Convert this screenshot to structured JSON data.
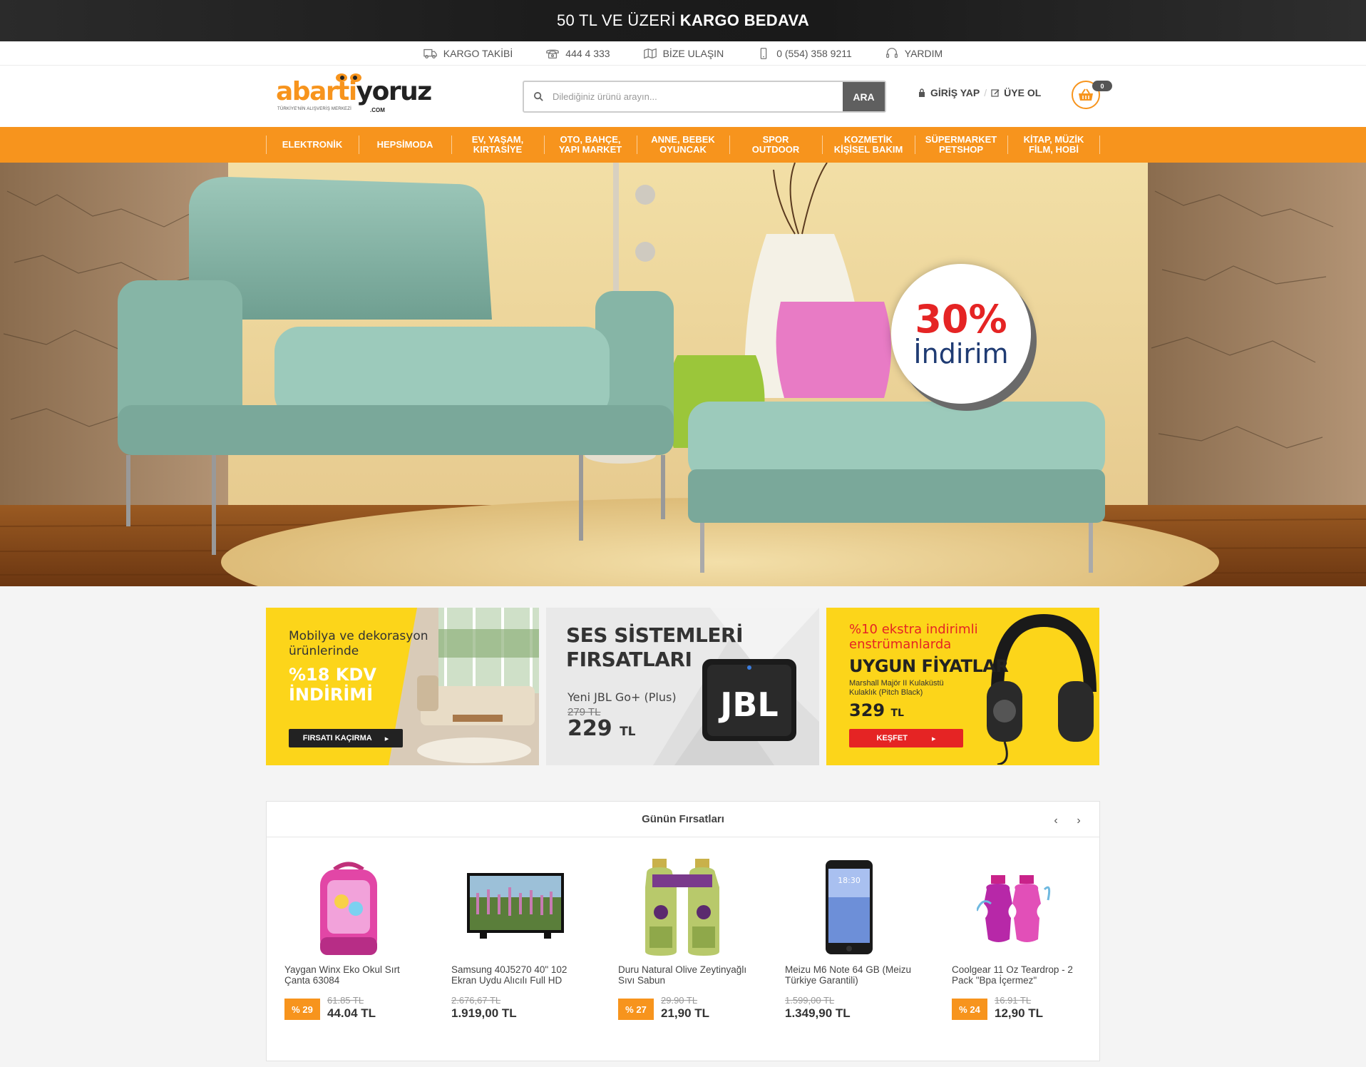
{
  "promo": {
    "text_normal": "50 TL VE ÜZERİ",
    "text_bold": "KARGO BEDAVA"
  },
  "utility": [
    {
      "icon": "truck-icon",
      "label": "KARGO TAKİBİ"
    },
    {
      "icon": "phone-icon",
      "label": "444 4 333"
    },
    {
      "icon": "map-icon",
      "label": "BİZE ULAŞIN"
    },
    {
      "icon": "mobile-icon",
      "label": "0 (554) 358 9211"
    },
    {
      "icon": "headset-icon",
      "label": "YARDIM"
    }
  ],
  "logo": {
    "part1": "abarti",
    "part2": "yoruz",
    "tagline": "TÜRKİYE'NİN ALIŞVERİŞ MERKEZİ",
    "domain": ".COM"
  },
  "search": {
    "placeholder": "Dilediğiniz ürünü arayın...",
    "button": "ARA"
  },
  "account": {
    "login": "GİRİŞ YAP",
    "register": "ÜYE OL"
  },
  "cart": {
    "count": "0"
  },
  "categories": [
    {
      "line1": "ELEKTRONİK",
      "line2": ""
    },
    {
      "line1": "HEPSİMODA",
      "line2": ""
    },
    {
      "line1": "EV, YAŞAM,",
      "line2": "KIRTASİYE"
    },
    {
      "line1": "OTO, BAHÇE,",
      "line2": "YAPI MARKET"
    },
    {
      "line1": "ANNE, BEBEK",
      "line2": "OYUNCAK"
    },
    {
      "line1": "SPOR",
      "line2": "OUTDOOR"
    },
    {
      "line1": "KOZMETİK",
      "line2": "KİŞİSEL BAKIM"
    },
    {
      "line1": "SÜPERMARKET",
      "line2": "PETSHOP"
    },
    {
      "line1": "KİTAP, MÜZİK",
      "line2": "FİLM, HOBİ"
    }
  ],
  "hero": {
    "badge_pct": "30%",
    "badge_text": "İndirim"
  },
  "banners": {
    "b1": {
      "line1": "Mobilya ve dekorasyon",
      "line2": "ürünlerinde",
      "line3": "%18 KDV",
      "line4": "İNDİRİMİ",
      "button": "FIRSATI KAÇIRMA"
    },
    "b2": {
      "line1": "SES SİSTEMLERİ",
      "line2": "FIRSATLARI",
      "product": "Yeni JBL Go+ (Plus)",
      "old_price": "279 TL",
      "new_price": "229",
      "currency": "TL",
      "brand": "JBL"
    },
    "b3": {
      "line1": "%10 ekstra indirimli",
      "line2": "enstrümanlarda",
      "headline": "UYGUN FİYATLAR",
      "desc1": "Marshall Majör II Kulaküstü",
      "desc2": "Kulaklık (Pitch Black)",
      "price": "329",
      "currency": "TL",
      "button": "KEŞFET"
    }
  },
  "deals": {
    "title": "Günün Fırsatları",
    "prev": "‹",
    "next": "›",
    "products": [
      {
        "name": "Yaygan Winx Eko Okul Sırt Çanta 63084",
        "discount": "% 29",
        "old_price": "61.85 TL",
        "new_price": "44.04 TL",
        "has_discount": true
      },
      {
        "name": "Samsung 40J5270 40\" 102 Ekran Uydu Alıcılı Full HD",
        "discount": "",
        "old_price": "2.676,67 TL",
        "new_price": "1.919,00 TL",
        "has_discount": false
      },
      {
        "name": "Duru Natural Olive Zeytinyağlı Sıvı Sabun",
        "discount": "% 27",
        "old_price": "29.90 TL",
        "new_price": "21,90 TL",
        "has_discount": true
      },
      {
        "name": "Meizu M6 Note 64 GB (Meizu Türkiye Garantili)",
        "discount": "",
        "old_price": "1.599,00 TL",
        "new_price": "1.349,90 TL",
        "has_discount": false
      },
      {
        "name": "Coolgear 11 Oz Teardrop - 2 Pack \"Bpa İçermez\"",
        "discount": "% 24",
        "old_price": "16.91 TL",
        "new_price": "12,90 TL",
        "has_discount": true
      }
    ]
  },
  "colors": {
    "accent": "#f7941d",
    "red": "#e52424",
    "yellow": "#fcd51a"
  }
}
